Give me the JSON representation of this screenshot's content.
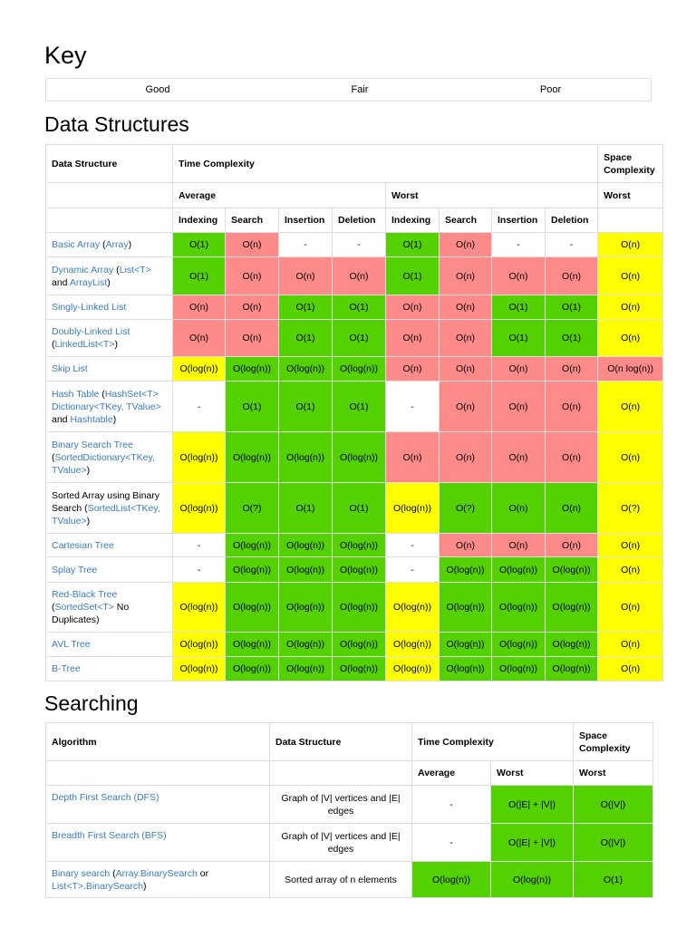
{
  "key": {
    "title": "Key",
    "items": [
      {
        "label": "Good",
        "color": "#53d100"
      },
      {
        "label": "Fair",
        "color": "#ffff00"
      },
      {
        "label": "Poor",
        "color": "#ff8a8a"
      }
    ]
  },
  "data_structures": {
    "title": "Data Structures",
    "headers": {
      "data_structure": "Data Structure",
      "time_complexity": "Time Complexity",
      "space_complexity": "Space Complexity",
      "average": "Average",
      "worst": "Worst",
      "space_worst": "Worst",
      "ops": [
        "Indexing",
        "Search",
        "Insertion",
        "Deletion"
      ]
    },
    "rows": [
      {
        "name": [
          {
            "t": "Basic Array",
            "link": true
          },
          {
            "t": " (",
            "link": false
          },
          {
            "t": "Array",
            "link": true
          },
          {
            "t": ")",
            "link": false
          }
        ],
        "cells": [
          [
            "O(1)",
            "g"
          ],
          [
            "O(n)",
            "r"
          ],
          [
            "-",
            "w"
          ],
          [
            "-",
            "w"
          ],
          [
            "O(1)",
            "g"
          ],
          [
            "O(n)",
            "r"
          ],
          [
            "-",
            "w"
          ],
          [
            "-",
            "w"
          ],
          [
            "O(n)",
            "y"
          ]
        ]
      },
      {
        "name": [
          {
            "t": "Dynamic Array",
            "link": true
          },
          {
            "t": " (",
            "link": false
          },
          {
            "t": "List<T>",
            "link": true
          },
          {
            "t": " and ",
            "link": false
          },
          {
            "t": "ArrayList",
            "link": true
          },
          {
            "t": ")",
            "link": false
          }
        ],
        "cells": [
          [
            "O(1)",
            "g"
          ],
          [
            "O(n)",
            "r"
          ],
          [
            "O(n)",
            "r"
          ],
          [
            "O(n)",
            "r"
          ],
          [
            "O(1)",
            "g"
          ],
          [
            "O(n)",
            "r"
          ],
          [
            "O(n)",
            "r"
          ],
          [
            "O(n)",
            "r"
          ],
          [
            "O(n)",
            "y"
          ]
        ]
      },
      {
        "name": [
          {
            "t": "Singly-Linked List",
            "link": true
          }
        ],
        "cells": [
          [
            "O(n)",
            "r"
          ],
          [
            "O(n)",
            "r"
          ],
          [
            "O(1)",
            "g"
          ],
          [
            "O(1)",
            "g"
          ],
          [
            "O(n)",
            "r"
          ],
          [
            "O(n)",
            "r"
          ],
          [
            "O(1)",
            "g"
          ],
          [
            "O(1)",
            "g"
          ],
          [
            "O(n)",
            "y"
          ]
        ]
      },
      {
        "name": [
          {
            "t": "Doubly-Linked List",
            "link": true
          },
          {
            "t": " (",
            "link": false
          },
          {
            "t": "LinkedList<T>",
            "link": true
          },
          {
            "t": ")",
            "link": false
          }
        ],
        "cells": [
          [
            "O(n)",
            "r"
          ],
          [
            "O(n)",
            "r"
          ],
          [
            "O(1)",
            "g"
          ],
          [
            "O(1)",
            "g"
          ],
          [
            "O(n)",
            "r"
          ],
          [
            "O(n)",
            "r"
          ],
          [
            "O(1)",
            "g"
          ],
          [
            "O(1)",
            "g"
          ],
          [
            "O(n)",
            "y"
          ]
        ]
      },
      {
        "name": [
          {
            "t": "Skip List",
            "link": true
          }
        ],
        "cells": [
          [
            "O(log(n))",
            "y"
          ],
          [
            "O(log(n))",
            "g"
          ],
          [
            "O(log(n))",
            "g"
          ],
          [
            "O(log(n))",
            "g"
          ],
          [
            "O(n)",
            "r"
          ],
          [
            "O(n)",
            "r"
          ],
          [
            "O(n)",
            "r"
          ],
          [
            "O(n)",
            "r"
          ],
          [
            "O(n log(n))",
            "r"
          ]
        ]
      },
      {
        "name": [
          {
            "t": "Hash Table",
            "link": true
          },
          {
            "t": " (",
            "link": false
          },
          {
            "t": "HashSet<T>",
            "link": true
          },
          {
            "t": " ",
            "link": false
          },
          {
            "t": "Dictionary<TKey, TValue>",
            "link": true
          },
          {
            "t": " and ",
            "link": false
          },
          {
            "t": "Hashtable",
            "link": true
          },
          {
            "t": ")",
            "link": false
          }
        ],
        "cells": [
          [
            "-",
            "w"
          ],
          [
            "O(1)",
            "g"
          ],
          [
            "O(1)",
            "g"
          ],
          [
            "O(1)",
            "g"
          ],
          [
            "-",
            "w"
          ],
          [
            "O(n)",
            "r"
          ],
          [
            "O(n)",
            "r"
          ],
          [
            "O(n)",
            "r"
          ],
          [
            "O(n)",
            "y"
          ]
        ]
      },
      {
        "name": [
          {
            "t": "Binary Search Tree",
            "link": true
          },
          {
            "t": " (",
            "link": false
          },
          {
            "t": "SortedDictionary<TKey, TValue>",
            "link": true
          },
          {
            "t": ")",
            "link": false
          }
        ],
        "cells": [
          [
            "O(log(n))",
            "y"
          ],
          [
            "O(log(n))",
            "g"
          ],
          [
            "O(log(n))",
            "g"
          ],
          [
            "O(log(n))",
            "g"
          ],
          [
            "O(n)",
            "r"
          ],
          [
            "O(n)",
            "r"
          ],
          [
            "O(n)",
            "r"
          ],
          [
            "O(n)",
            "r"
          ],
          [
            "O(n)",
            "y"
          ]
        ]
      },
      {
        "name": [
          {
            "t": "Sorted Array using Binary Search (",
            "link": false
          },
          {
            "t": "SortedList<TKey, TValue>",
            "link": true
          },
          {
            "t": ")",
            "link": false
          }
        ],
        "cells": [
          [
            "O(log(n))",
            "y"
          ],
          [
            "O(?)",
            "g"
          ],
          [
            "O(1)",
            "g"
          ],
          [
            "O(1)",
            "g"
          ],
          [
            "O(log(n))",
            "y"
          ],
          [
            "O(?)",
            "g"
          ],
          [
            "O(n)",
            "g"
          ],
          [
            "O(n)",
            "g"
          ],
          [
            "O(?)",
            "y"
          ]
        ]
      },
      {
        "name": [
          {
            "t": "Cartesian Tree",
            "link": true
          }
        ],
        "cells": [
          [
            "-",
            "w"
          ],
          [
            "O(log(n))",
            "g"
          ],
          [
            "O(log(n))",
            "g"
          ],
          [
            "O(log(n))",
            "g"
          ],
          [
            "-",
            "w"
          ],
          [
            "O(n)",
            "r"
          ],
          [
            "O(n)",
            "r"
          ],
          [
            "O(n)",
            "r"
          ],
          [
            "O(n)",
            "y"
          ]
        ]
      },
      {
        "name": [
          {
            "t": "Splay Tree",
            "link": true
          }
        ],
        "cells": [
          [
            "-",
            "w"
          ],
          [
            "O(log(n))",
            "g"
          ],
          [
            "O(log(n))",
            "g"
          ],
          [
            "O(log(n))",
            "g"
          ],
          [
            "-",
            "w"
          ],
          [
            "O(log(n))",
            "g"
          ],
          [
            "O(log(n))",
            "g"
          ],
          [
            "O(log(n))",
            "g"
          ],
          [
            "O(n)",
            "y"
          ]
        ]
      },
      {
        "name": [
          {
            "t": "Red-Black Tree",
            "link": true
          },
          {
            "t": " (",
            "link": false
          },
          {
            "t": "SortedSet<T>",
            "link": true
          },
          {
            "t": " No Duplicates)",
            "link": false
          }
        ],
        "cells": [
          [
            "O(log(n))",
            "y"
          ],
          [
            "O(log(n))",
            "g"
          ],
          [
            "O(log(n))",
            "g"
          ],
          [
            "O(log(n))",
            "g"
          ],
          [
            "O(log(n))",
            "y"
          ],
          [
            "O(log(n))",
            "g"
          ],
          [
            "O(log(n))",
            "g"
          ],
          [
            "O(log(n))",
            "g"
          ],
          [
            "O(n)",
            "y"
          ]
        ]
      },
      {
        "name": [
          {
            "t": "AVL Tree",
            "link": true
          }
        ],
        "cells": [
          [
            "O(log(n))",
            "y"
          ],
          [
            "O(log(n))",
            "g"
          ],
          [
            "O(log(n))",
            "g"
          ],
          [
            "O(log(n))",
            "g"
          ],
          [
            "O(log(n))",
            "y"
          ],
          [
            "O(log(n))",
            "g"
          ],
          [
            "O(log(n))",
            "g"
          ],
          [
            "O(log(n))",
            "g"
          ],
          [
            "O(n)",
            "y"
          ]
        ]
      },
      {
        "name": [
          {
            "t": "B-Tree",
            "link": true
          }
        ],
        "cells": [
          [
            "O(log(n))",
            "y"
          ],
          [
            "O(log(n))",
            "g"
          ],
          [
            "O(log(n))",
            "g"
          ],
          [
            "O(log(n))",
            "g"
          ],
          [
            "O(log(n))",
            "y"
          ],
          [
            "O(log(n))",
            "g"
          ],
          [
            "O(log(n))",
            "g"
          ],
          [
            "O(log(n))",
            "g"
          ],
          [
            "O(n)",
            "y"
          ]
        ]
      }
    ]
  },
  "searching": {
    "title": "Searching",
    "headers": {
      "algorithm": "Algorithm",
      "data_structure": "Data Structure",
      "time_complexity": "Time Complexity",
      "space_complexity": "Space Complexity",
      "average": "Average",
      "worst": "Worst",
      "space_worst": "Worst"
    },
    "rows": [
      {
        "name": [
          {
            "t": "Depth First Search (DFS)",
            "link": true
          }
        ],
        "structure": "Graph of |V| vertices and |E| edges",
        "cells": [
          [
            "-",
            "w"
          ],
          [
            "O(|E| + |V|)",
            "g"
          ],
          [
            "O(|V|)",
            "g"
          ]
        ]
      },
      {
        "name": [
          {
            "t": "Breadth First Search (BFS)",
            "link": true
          }
        ],
        "structure": "Graph of |V| vertices and |E| edges",
        "cells": [
          [
            "-",
            "w"
          ],
          [
            "O(|E| + |V|)",
            "g"
          ],
          [
            "O(|V|)",
            "g"
          ]
        ]
      },
      {
        "name": [
          {
            "t": "Binary search",
            "link": true
          },
          {
            "t": " (",
            "link": false
          },
          {
            "t": "Array.BinarySearch",
            "link": true
          },
          {
            "t": " or ",
            "link": false
          },
          {
            "t": "List<T>.BinarySearch",
            "link": true
          },
          {
            "t": ")",
            "link": false
          }
        ],
        "structure": "Sorted array of n elements",
        "cells": [
          [
            "O(log(n))",
            "g"
          ],
          [
            "O(log(n))",
            "g"
          ],
          [
            "O(1)",
            "g"
          ]
        ]
      }
    ]
  }
}
